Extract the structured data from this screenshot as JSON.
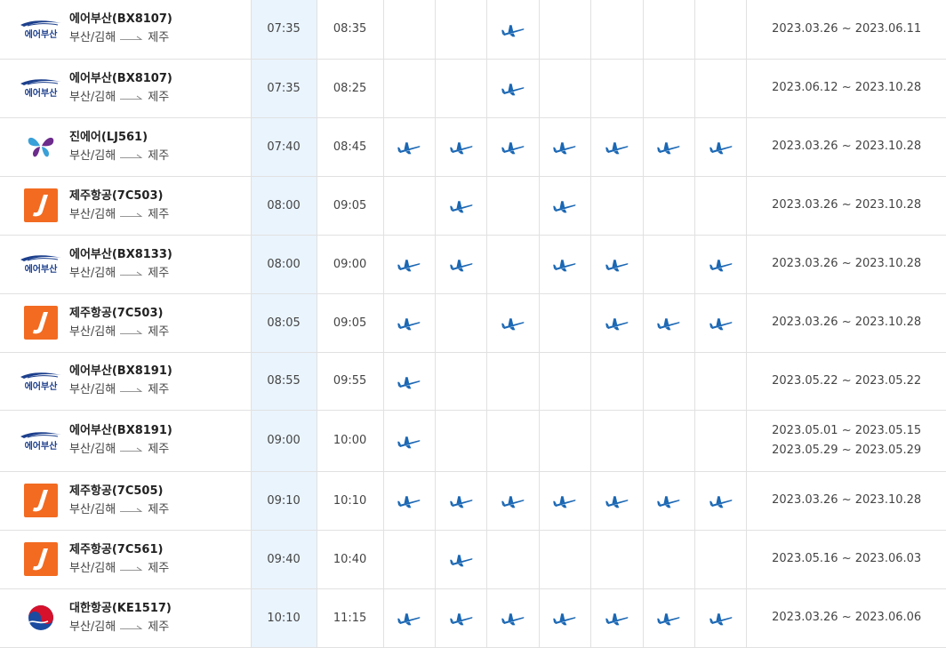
{
  "colors": {
    "plane": "#1a67b4",
    "dep_col_bg": "#eaf4fd",
    "airbusan": "#1c3f8c",
    "jejuair": "#f26b21",
    "jinair_purple": "#6c2c8c",
    "jinair_blue": "#3aa0d8",
    "korean_red": "#d6112b",
    "korean_blue": "#1b4ba0"
  },
  "flights": [
    {
      "logo": "airbusan",
      "logo_text": "에어부산",
      "airline": "에어부산(BX8107)",
      "origin": "부산/김해",
      "dest": "제주",
      "dep": "07:35",
      "arr": "08:35",
      "days": [
        false,
        false,
        true,
        false,
        false,
        false,
        false
      ],
      "periods": [
        "2023.03.26 ~ 2023.06.11"
      ]
    },
    {
      "logo": "airbusan",
      "logo_text": "에어부산",
      "airline": "에어부산(BX8107)",
      "origin": "부산/김해",
      "dest": "제주",
      "dep": "07:35",
      "arr": "08:25",
      "days": [
        false,
        false,
        true,
        false,
        false,
        false,
        false
      ],
      "periods": [
        "2023.06.12 ~ 2023.10.28"
      ]
    },
    {
      "logo": "jinair",
      "logo_text": "",
      "airline": "진에어(LJ561)",
      "origin": "부산/김해",
      "dest": "제주",
      "dep": "07:40",
      "arr": "08:45",
      "days": [
        true,
        true,
        true,
        true,
        true,
        true,
        true
      ],
      "periods": [
        "2023.03.26 ~ 2023.10.28"
      ]
    },
    {
      "logo": "jejuair",
      "logo_text": "",
      "airline": "제주항공(7C503)",
      "origin": "부산/김해",
      "dest": "제주",
      "dep": "08:00",
      "arr": "09:05",
      "days": [
        false,
        true,
        false,
        true,
        false,
        false,
        false
      ],
      "periods": [
        "2023.03.26 ~ 2023.10.28"
      ]
    },
    {
      "logo": "airbusan",
      "logo_text": "에어부산",
      "airline": "에어부산(BX8133)",
      "origin": "부산/김해",
      "dest": "제주",
      "dep": "08:00",
      "arr": "09:00",
      "days": [
        true,
        true,
        false,
        true,
        true,
        false,
        true
      ],
      "periods": [
        "2023.03.26 ~ 2023.10.28"
      ]
    },
    {
      "logo": "jejuair",
      "logo_text": "",
      "airline": "제주항공(7C503)",
      "origin": "부산/김해",
      "dest": "제주",
      "dep": "08:05",
      "arr": "09:05",
      "days": [
        true,
        false,
        true,
        false,
        true,
        true,
        true
      ],
      "periods": [
        "2023.03.26 ~ 2023.10.28"
      ]
    },
    {
      "logo": "airbusan",
      "logo_text": "에어부산",
      "airline": "에어부산(BX8191)",
      "origin": "부산/김해",
      "dest": "제주",
      "dep": "08:55",
      "arr": "09:55",
      "days": [
        true,
        false,
        false,
        false,
        false,
        false,
        false
      ],
      "periods": [
        "2023.05.22 ~ 2023.05.22"
      ]
    },
    {
      "logo": "airbusan",
      "logo_text": "에어부산",
      "airline": "에어부산(BX8191)",
      "origin": "부산/김해",
      "dest": "제주",
      "dep": "09:00",
      "arr": "10:00",
      "days": [
        true,
        false,
        false,
        false,
        false,
        false,
        false
      ],
      "periods": [
        "2023.05.01 ~ 2023.05.15",
        "2023.05.29 ~ 2023.05.29"
      ]
    },
    {
      "logo": "jejuair",
      "logo_text": "",
      "airline": "제주항공(7C505)",
      "origin": "부산/김해",
      "dest": "제주",
      "dep": "09:10",
      "arr": "10:10",
      "days": [
        true,
        true,
        true,
        true,
        true,
        true,
        true
      ],
      "periods": [
        "2023.03.26 ~ 2023.10.28"
      ]
    },
    {
      "logo": "jejuair",
      "logo_text": "",
      "airline": "제주항공(7C561)",
      "origin": "부산/김해",
      "dest": "제주",
      "dep": "09:40",
      "arr": "10:40",
      "days": [
        false,
        true,
        false,
        false,
        false,
        false,
        false
      ],
      "periods": [
        "2023.05.16 ~ 2023.06.03"
      ]
    },
    {
      "logo": "korean",
      "logo_text": "",
      "airline": "대한항공(KE1517)",
      "origin": "부산/김해",
      "dest": "제주",
      "dep": "10:10",
      "arr": "11:15",
      "days": [
        true,
        true,
        true,
        true,
        true,
        true,
        true
      ],
      "periods": [
        "2023.03.26 ~ 2023.06.06"
      ]
    }
  ]
}
